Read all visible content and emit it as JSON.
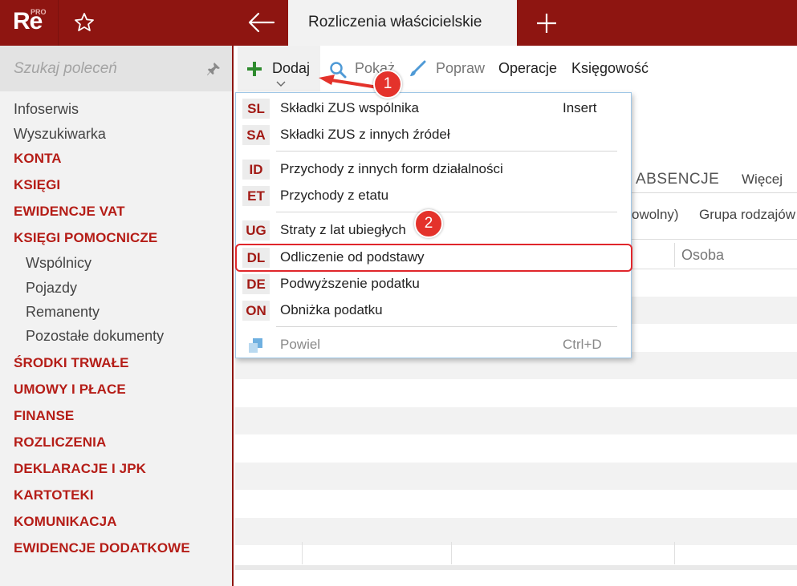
{
  "logo": {
    "text": "Re",
    "superscript": "PRO"
  },
  "topbar": {
    "favorite_icon": "star-icon",
    "back_icon": "arrow-left-icon",
    "active_tab": "Rozliczenia właścicielskie",
    "new_tab_icon": "plus-icon",
    "color": "#8e1511"
  },
  "sidebar": {
    "search_placeholder": "Szukaj poleceń",
    "pin_icon": "pin-icon",
    "items": [
      {
        "label": "Infoserwis",
        "kind": "plain"
      },
      {
        "label": "Wyszukiwarka",
        "kind": "plain"
      },
      {
        "label": "KONTA",
        "kind": "section"
      },
      {
        "label": "KSIĘGI",
        "kind": "section"
      },
      {
        "label": "EWIDENCJE VAT",
        "kind": "section"
      },
      {
        "label": "KSIĘGI POMOCNICZE",
        "kind": "section"
      },
      {
        "label": "Wspólnicy",
        "kind": "sub"
      },
      {
        "label": "Pojazdy",
        "kind": "sub"
      },
      {
        "label": "Remanenty",
        "kind": "sub"
      },
      {
        "label": "Pozostałe dokumenty",
        "kind": "sub"
      },
      {
        "label": "ŚRODKI TRWAŁE",
        "kind": "section"
      },
      {
        "label": "UMOWY I PŁACE",
        "kind": "section"
      },
      {
        "label": "FINANSE",
        "kind": "section"
      },
      {
        "label": "ROZLICZENIA",
        "kind": "section"
      },
      {
        "label": "DEKLARACJE I JPK",
        "kind": "section"
      },
      {
        "label": "KARTOTEKI",
        "kind": "section"
      },
      {
        "label": "KOMUNIKACJA",
        "kind": "section"
      },
      {
        "label": "EWIDENCJE DODATKOWE",
        "kind": "section"
      }
    ]
  },
  "toolbar": {
    "add_label": "Dodaj",
    "show_label": "Pokaż",
    "edit_label": "Popraw",
    "operations_label": "Operacje",
    "accounting_label": "Księgowość"
  },
  "tabs": {
    "absence": "ABSENCJE",
    "more": "Więcej"
  },
  "filters": {
    "partial": "owolny)",
    "group": "Grupa rodzajów"
  },
  "grid": {
    "person_header": "Osoba"
  },
  "menu": {
    "items": [
      {
        "code": "SL",
        "label": "Składki ZUS wspólnika",
        "shortcut": "Insert"
      },
      {
        "code": "SA",
        "label": "Składki ZUS z innych źródeł",
        "shortcut": ""
      },
      {
        "code": "ID",
        "label": "Przychody z innych form działalności",
        "shortcut": ""
      },
      {
        "code": "ET",
        "label": "Przychody z etatu",
        "shortcut": ""
      },
      {
        "code": "UG",
        "label": "Straty z lat ubiegłych",
        "shortcut": ""
      },
      {
        "code": "DL",
        "label": "Odliczenie od podstawy",
        "shortcut": ""
      },
      {
        "code": "DE",
        "label": "Podwyższenie podatku",
        "shortcut": ""
      },
      {
        "code": "ON",
        "label": "Obniżka podatku",
        "shortcut": ""
      }
    ],
    "repeat": {
      "label": "Powiel",
      "shortcut": "Ctrl+D",
      "icon": "copy-icon"
    }
  },
  "annotations": {
    "step1": "1",
    "step2": "2",
    "accent": "#e4322b"
  }
}
